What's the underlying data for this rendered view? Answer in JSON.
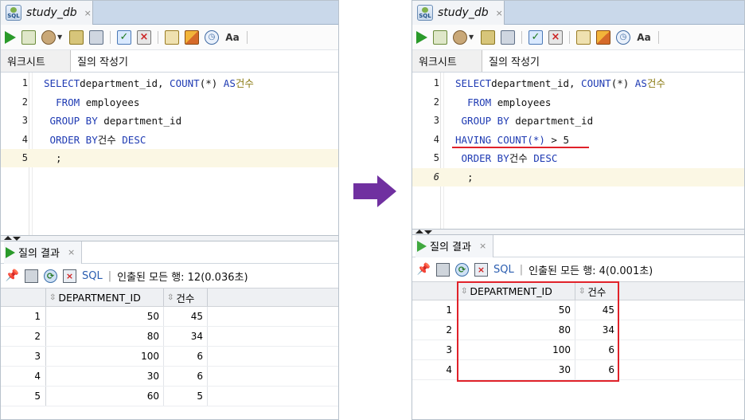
{
  "colors": {
    "keyword": "#1f3bb3",
    "korean_alias": "#8a7a12",
    "highlight_line": "#fbf7e4",
    "annotation_red": "#e0222a",
    "arrow_purple": "#7030a0",
    "run_green": "#2a9a2a",
    "sql_link": "#2a5db0"
  },
  "left": {
    "doc_tab": {
      "label": "study_db",
      "close": "×"
    },
    "subtabs": [
      "워크시트",
      "질의 작성기"
    ],
    "editor": {
      "lines": [
        {
          "num": "1",
          "parts": [
            [
              "kw",
              "SELECT"
            ],
            [
              "",
              "department_id, "
            ],
            [
              "kw",
              "COUNT"
            ],
            [
              "",
              "(*) "
            ],
            [
              "kw",
              "AS"
            ],
            [
              "",
              ""
            ],
            [
              "ko",
              "건수"
            ]
          ]
        },
        {
          "num": "2",
          "parts": [
            [
              "",
              "  "
            ],
            [
              "kw",
              "FROM"
            ],
            [
              "",
              " employees"
            ]
          ]
        },
        {
          "num": "3",
          "parts": [
            [
              "",
              ""
            ],
            [
              "kw",
              " GROUP BY"
            ],
            [
              "",
              " department_id"
            ]
          ]
        },
        {
          "num": "4",
          "parts": [
            [
              "",
              ""
            ],
            [
              "kw",
              " ORDER BY"
            ],
            [
              "",
              ""
            ],
            [
              "kob",
              "건수"
            ],
            [
              "kw",
              " DESC"
            ]
          ]
        },
        {
          "num": "5",
          "parts": [
            [
              "",
              "  ;"
            ]
          ]
        }
      ]
    },
    "result": {
      "tab_label": "질의 결과",
      "close": "×",
      "sql_label": "SQL",
      "status": "인출된 모든 행: 12(0.036초)",
      "columns": [
        "DEPARTMENT_ID",
        "건수"
      ],
      "rows": [
        [
          "1",
          "50",
          "45"
        ],
        [
          "2",
          "80",
          "34"
        ],
        [
          "3",
          "100",
          "6"
        ],
        [
          "4",
          "30",
          "6"
        ],
        [
          "5",
          "60",
          "5"
        ]
      ]
    }
  },
  "right": {
    "doc_tab": {
      "label": "study_db",
      "close": "×"
    },
    "subtabs": [
      "워크시트",
      "질의 작성기"
    ],
    "editor": {
      "lines": [
        {
          "num": "1",
          "parts": [
            [
              "kw",
              "SELECT"
            ],
            [
              "",
              "department_id, "
            ],
            [
              "kw",
              "COUNT"
            ],
            [
              "",
              "(*) "
            ],
            [
              "kw",
              "AS"
            ],
            [
              "",
              ""
            ],
            [
              "ko",
              "건수"
            ]
          ]
        },
        {
          "num": "2",
          "parts": [
            [
              "",
              "  "
            ],
            [
              "kw",
              "FROM"
            ],
            [
              "",
              " employees"
            ]
          ]
        },
        {
          "num": "3",
          "parts": [
            [
              "",
              ""
            ],
            [
              "kw",
              " GROUP BY"
            ],
            [
              "",
              " department_id"
            ]
          ]
        },
        {
          "num": "4",
          "parts": [
            [
              "kw",
              "HAVING COUNT"
            ],
            [
              "kw",
              "(*)"
            ],
            [
              "",
              " > 5"
            ]
          ]
        },
        {
          "num": "5",
          "parts": [
            [
              "",
              ""
            ],
            [
              "kw",
              " ORDER BY"
            ],
            [
              "",
              ""
            ],
            [
              "kob",
              "건수"
            ],
            [
              "kw",
              " DESC"
            ]
          ]
        },
        {
          "num": "6",
          "parts": [
            [
              "",
              "  ;"
            ]
          ]
        }
      ]
    },
    "result": {
      "tab_label": "질의 결과",
      "close": "×",
      "sql_label": "SQL",
      "status": "인출된 모든 행: 4(0.001초)",
      "columns": [
        "DEPARTMENT_ID",
        "건수"
      ],
      "rows": [
        [
          "1",
          "50",
          "45"
        ],
        [
          "2",
          "80",
          "34"
        ],
        [
          "3",
          "100",
          "6"
        ],
        [
          "4",
          "30",
          "6"
        ]
      ]
    }
  }
}
